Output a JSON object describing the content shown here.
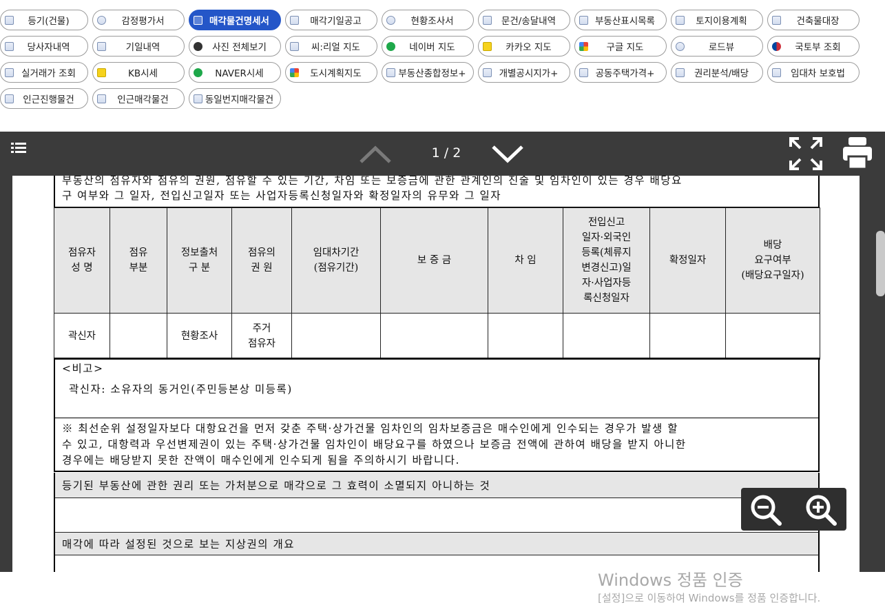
{
  "buttons": [
    {
      "label": "등기(건물)",
      "active": false
    },
    {
      "label": "감정평가서",
      "active": false
    },
    {
      "label": "매각물건명세서",
      "active": true
    },
    {
      "label": "매각기일공고",
      "active": false
    },
    {
      "label": "현황조사서",
      "active": false
    },
    {
      "label": "문건/송달내역",
      "active": false
    },
    {
      "label": "부동산표시목록",
      "active": false
    },
    {
      "label": "토지이용계획",
      "active": false
    },
    {
      "label": "건축물대장",
      "active": false
    },
    {
      "label": "당사자내역",
      "active": false
    },
    {
      "label": "기일내역",
      "active": false
    },
    {
      "label": "사진 전체보기",
      "active": false
    },
    {
      "label": "씨:리얼 지도",
      "active": false
    },
    {
      "label": "네이버 지도",
      "active": false
    },
    {
      "label": "카카오 지도",
      "active": false
    },
    {
      "label": "구글 지도",
      "active": false
    },
    {
      "label": "로드뷰",
      "active": false
    },
    {
      "label": "국토부 조회",
      "active": false
    },
    {
      "label": "실거래가 조회",
      "active": false
    },
    {
      "label": "KB시세",
      "active": false
    },
    {
      "label": "NAVER시세",
      "active": false
    },
    {
      "label": "도시계획지도",
      "active": false
    },
    {
      "label": "부동산종합정보+",
      "active": false
    },
    {
      "label": "개별공시지가+",
      "active": false
    },
    {
      "label": "공동주택가격+",
      "active": false
    },
    {
      "label": "권리분석/배당",
      "active": false
    },
    {
      "label": "임대차 보호법",
      "active": false
    },
    {
      "label": "인근진행물건",
      "active": false
    },
    {
      "label": "인근매각물건",
      "active": false
    },
    {
      "label": "동일번지매각물건",
      "active": false
    }
  ],
  "viewer": {
    "page_indicator": "1 / 2"
  },
  "document": {
    "intro_line1": "부동산의 점유자와 점유의 권원, 점유할 수 있는 기간, 차임 또는 보증금에 관한 관계인의 진술 및 임차인이 있는 경우 배당요",
    "intro_line2": "구 여부와 그 일자, 전입신고일자 또는 사업자등록신청일자와 확정일자의 유무와 그 일자",
    "headers": [
      [
        "점유자",
        "성 명"
      ],
      [
        "점유",
        "부분"
      ],
      [
        "정보출처",
        "구 분"
      ],
      [
        "점유의",
        "권 원"
      ],
      [
        "임대차기간",
        "(점유기간)"
      ],
      [
        "보 증 금"
      ],
      [
        "차 임"
      ],
      [
        "전입신고",
        "일자·외국인",
        "등록(체류지",
        "변경신고)일",
        "자·사업자등",
        "록신청일자"
      ],
      [
        "확정일자"
      ],
      [
        "배당",
        "요구여부",
        "(배당요구일자)"
      ]
    ],
    "row": [
      [
        "곽신자"
      ],
      [
        ""
      ],
      [
        "현황조사"
      ],
      [
        "주거",
        "점유자"
      ],
      [
        ""
      ],
      [
        ""
      ],
      [
        ""
      ],
      [
        ""
      ],
      [
        ""
      ],
      [
        ""
      ]
    ],
    "note_label": "<비고>",
    "note_text": "곽신자: 소유자의 동거인(주민등본상 미등록)",
    "warning_line1": "※ 최선순위 설정일자보다 대항요건을 먼저 갖춘 주택·상가건물 임차인의 임차보증금은 매수인에게 인수되는 경우가 발생 할",
    "warning_line2": "수 있고, 대항력과 우선변제권이 있는 주택·상가건물 임차인이 배당요구를 하였으나 보증금 전액에 관하여 배당을 받지 아니한",
    "warning_line3": "경우에는 배당받지 못한 잔액이 매수인에게 인수되게 됨을 주의하시기 바랍니다.",
    "section1": "등기된 부동산에 관한 권리 또는 가처분으로 매각으로 그 효력이 소멸되지 아니하는 것",
    "section2": "매각에 따라 설정된 것으로 보는 지상권의 개요"
  },
  "watermark": {
    "line1": "Windows 정품 인증",
    "line2": "[설정]으로 이동하여 Windows를 정품 인증합니다."
  },
  "icons": [
    "doc-icon",
    "search-icon",
    "doc-icon",
    "doc-icon",
    "person-icon",
    "doc-icon",
    "doc-icon",
    "doc-icon",
    "doc-icon",
    "doc-icon",
    "home-icon",
    "camera-icon",
    "map-icon",
    "naver-icon",
    "kakao-pin-icon",
    "google-maps-icon",
    "roadview-icon",
    "korea-gov-icon",
    "doc-icon",
    "kb-pin-icon",
    "naver-icon",
    "city-plan-icon",
    "doc-icon",
    "doc-icon",
    "doc-icon",
    "doc-icon",
    "doc-icon",
    "doc-icon",
    "doc-icon",
    "doc-icon"
  ]
}
